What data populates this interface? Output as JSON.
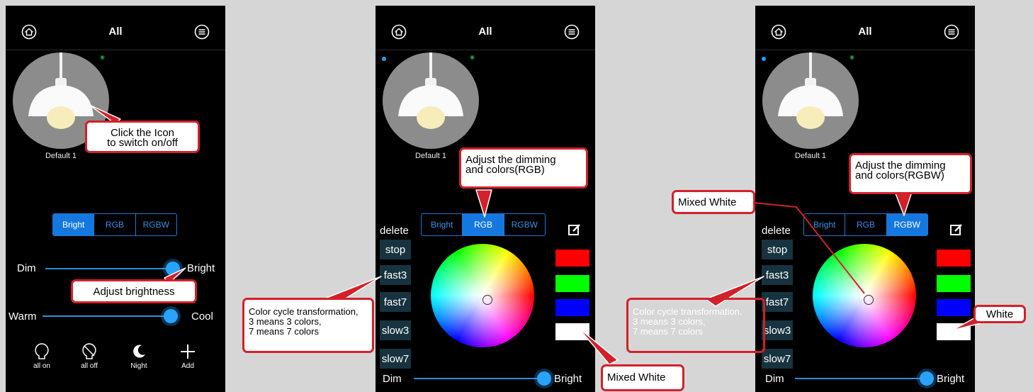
{
  "header": {
    "title": "All"
  },
  "lamp": {
    "name": "Default 1"
  },
  "tabs": [
    "Bright",
    "RGB",
    "RGBW"
  ],
  "screen1": {
    "dim_label": "Dim",
    "bright_label": "Bright",
    "warm_label": "Warm",
    "cool_label": "Cool",
    "brightness_level": 0.97,
    "temperature_level": 0.95,
    "buttons": [
      "all on",
      "all off",
      "Night",
      "Add"
    ],
    "active_tab": "Bright"
  },
  "screen2": {
    "active_tab": "RGB",
    "delete_label": "delete",
    "modes": [
      "stop",
      "fast3",
      "fast7",
      "slow3",
      "slow7"
    ],
    "dim_label": "Dim",
    "bright_label": "Bright",
    "swatch_colors": [
      "#ff0000",
      "#00ff00",
      "#0000ff",
      "#ffffff"
    ]
  },
  "screen3": {
    "active_tab": "RGBW",
    "delete_label": "delete",
    "modes": [
      "stop",
      "fast3",
      "fast7",
      "slow3",
      "slow7"
    ],
    "dim_label": "Dim",
    "bright_label": "Bright",
    "swatch_colors": [
      "#ff0000",
      "#00ff00",
      "#0000ff",
      "#ffffff"
    ]
  },
  "callouts": {
    "switch": [
      "Click the Icon",
      "to switch on/off"
    ],
    "brightness": "Adjust brightness",
    "rgb": [
      "Adjust the dimming",
      "and colors(RGB)"
    ],
    "rgbw": [
      "Adjust the dimming",
      "and colors(RGBW)"
    ],
    "cycle2": [
      "Color cycle transformation,",
      "3 means 3 colors,",
      "7 means 7 colors"
    ],
    "cycle3": [
      "Color cycle transformation.",
      "3 means 3 colors,",
      "7 means 7 colors"
    ],
    "mixed_white_bottom": "Mixed White",
    "mixed_white_top": "Mixed White",
    "white": "White"
  },
  "colors": {
    "accent": "#1478e0",
    "callout": "#d3202a",
    "mode_btn": "#17333f"
  }
}
